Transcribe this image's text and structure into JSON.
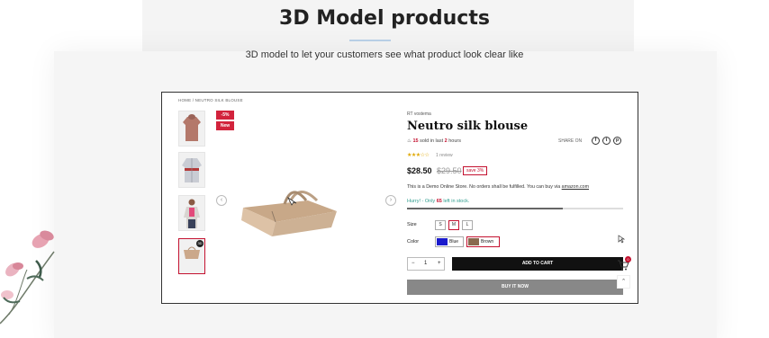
{
  "section": {
    "title": "3D Model products",
    "subtitle": "3D model to let your customers see what product look clear like"
  },
  "breadcrumb": {
    "home": "HOME",
    "separator": "/",
    "current": "NEUTRO SILK BLOUSE"
  },
  "gallery": {
    "thumbnails": [
      "hoodie",
      "jacket",
      "model-in-jacket",
      "tote-bag-3d"
    ],
    "active_thumbnail": 3,
    "badges": {
      "discount": "-5%",
      "new": "New"
    },
    "prev_arrow": "‹",
    "next_arrow": "›",
    "ar_icon": "3D"
  },
  "product": {
    "vendor": "RT vostema",
    "name": "Neutro silk blouse",
    "sold_count": "15",
    "sold_text": "sold in last",
    "sold_hours": "2",
    "hours_label": "hours",
    "share_label": "SHARE ON",
    "share_icons": [
      "f",
      "t",
      "p"
    ],
    "rating": 3,
    "rating_stars": "★★★☆☆",
    "review_text": "1 review",
    "price": "$28.50",
    "old_price": "$29.50",
    "save_label": "save 3%",
    "demo_text": "This is a Demo Online Store. No orders shall be fulfilled. You can buy via",
    "demo_link": "amazon.com",
    "hurry_prefix": "Hurry! - Only",
    "stock_left": "65",
    "hurry_suffix": "left in stock.",
    "stock_fraction": 0.72,
    "size_label": "Size",
    "sizes": [
      "S",
      "M",
      "L"
    ],
    "selected_size": "M",
    "color_label": "Color",
    "colors": [
      {
        "name": "Blue",
        "hex": "#1a1acc"
      },
      {
        "name": "Brown",
        "hex": "#8a6a4f"
      }
    ],
    "quantity": "1",
    "qty_minus": "−",
    "qty_plus": "+",
    "add_to_cart": "ADD TO CART",
    "buy_now": "BUY IT NOW",
    "cart_count": "0",
    "to_top": "⌃"
  },
  "colors": {
    "accent": "#c41230",
    "dark": "#111111",
    "grey_button": "#888888",
    "stock_text": "#2f9c8e"
  }
}
